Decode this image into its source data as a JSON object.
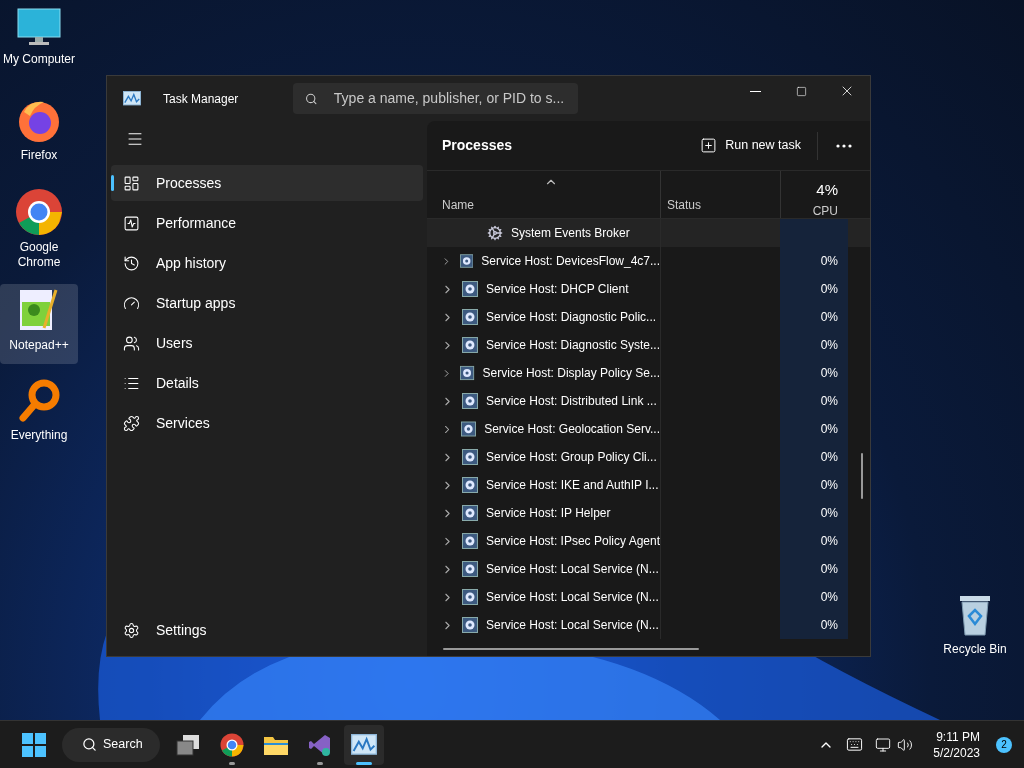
{
  "desktop_icons": [
    {
      "kind": "computer",
      "label": "My Computer",
      "selected": false
    },
    {
      "kind": "firefox",
      "label": "Firefox",
      "selected": false
    },
    {
      "kind": "chrome",
      "label": "Google Chrome",
      "selected": false
    },
    {
      "kind": "notepad",
      "label": "Notepad++",
      "selected": true
    },
    {
      "kind": "everything",
      "label": "Everything",
      "selected": false
    }
  ],
  "recycle_bin": {
    "label": "Recycle Bin"
  },
  "window": {
    "title": "Task Manager",
    "search": {
      "placeholder": "Type a name, publisher, or PID to s..."
    }
  },
  "sidebar": {
    "items": [
      {
        "kind": "processes",
        "label": "Processes",
        "selected": true
      },
      {
        "kind": "performance",
        "label": "Performance",
        "selected": false
      },
      {
        "kind": "history",
        "label": "App history",
        "selected": false
      },
      {
        "kind": "startup",
        "label": "Startup apps",
        "selected": false
      },
      {
        "kind": "users",
        "label": "Users",
        "selected": false
      },
      {
        "kind": "details",
        "label": "Details",
        "selected": false
      },
      {
        "kind": "services",
        "label": "Services",
        "selected": false
      }
    ],
    "settings": "Settings"
  },
  "page": {
    "title": "Processes",
    "run_new_task": "Run new task"
  },
  "table": {
    "columns": [
      {
        "label": "Name"
      },
      {
        "label": "Status"
      },
      {
        "label": "CPU",
        "total": "4%"
      }
    ],
    "rows": [
      {
        "kind": "child",
        "name": "System Events Broker",
        "cpu": ""
      },
      {
        "kind": "group",
        "name": "Service Host: DevicesFlow_4c7...",
        "cpu": "0%"
      },
      {
        "kind": "group",
        "name": "Service Host: DHCP Client",
        "cpu": "0%"
      },
      {
        "kind": "group",
        "name": "Service Host: Diagnostic Polic...",
        "cpu": "0%"
      },
      {
        "kind": "group",
        "name": "Service Host: Diagnostic Syste...",
        "cpu": "0%"
      },
      {
        "kind": "group",
        "name": "Service Host: Display Policy Se...",
        "cpu": "0%"
      },
      {
        "kind": "group",
        "name": "Service Host: Distributed Link ...",
        "cpu": "0%"
      },
      {
        "kind": "group",
        "name": "Service Host: Geolocation Serv...",
        "cpu": "0%"
      },
      {
        "kind": "group",
        "name": "Service Host: Group Policy Cli...",
        "cpu": "0%"
      },
      {
        "kind": "group",
        "name": "Service Host: IKE and AuthIP I...",
        "cpu": "0%"
      },
      {
        "kind": "group",
        "name": "Service Host: IP Helper",
        "cpu": "0%"
      },
      {
        "kind": "group",
        "name": "Service Host: IPsec Policy Agent",
        "cpu": "0%"
      },
      {
        "kind": "group",
        "name": "Service Host: Local Service (N...",
        "cpu": "0%"
      },
      {
        "kind": "group",
        "name": "Service Host: Local Service (N...",
        "cpu": "0%"
      },
      {
        "kind": "group",
        "name": "Service Host: Local Service (N...",
        "cpu": "0%"
      }
    ]
  },
  "taskbar": {
    "search": "Search",
    "apps": [
      {
        "kind": "taskview",
        "running": false,
        "selected": false
      },
      {
        "kind": "chrome",
        "running": true,
        "selected": false
      },
      {
        "kind": "explorer",
        "running": false,
        "selected": false
      },
      {
        "kind": "vs",
        "running": true,
        "selected": false
      },
      {
        "kind": "taskmgr",
        "running": true,
        "selected": true
      }
    ],
    "time": "9:11 PM",
    "date": "5/2/2023",
    "notifications": "2"
  }
}
